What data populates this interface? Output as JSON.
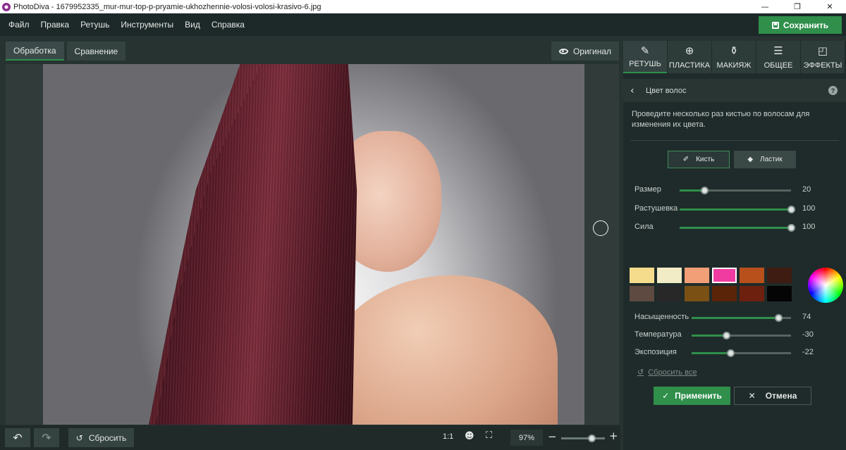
{
  "window": {
    "title": "PhotoDiva - 1679952335_mur-mur-top-p-pryamie-ukhozhennie-volosi-volosi-krasivo-6.jpg",
    "controls": [
      "—",
      "❐",
      "✕"
    ]
  },
  "menu": {
    "items": [
      "Файл",
      "Правка",
      "Ретушь",
      "Инструменты",
      "Вид",
      "Справка"
    ],
    "save_label": "Сохранить"
  },
  "view_tabs": [
    {
      "label": "Обработка",
      "active": true
    },
    {
      "label": "Сравнение",
      "active": false
    }
  ],
  "original_label": "Оригинал",
  "bottom": {
    "reset_label": "Сбросить",
    "ratio_label": "1:1",
    "zoom_value": "97%",
    "zoom_fraction": 0.7
  },
  "panel": {
    "tabs": [
      {
        "label": "РЕТУШЬ",
        "icon": "retouch-brush-icon",
        "active": true
      },
      {
        "label": "ПЛАСТИКА",
        "icon": "plastic-globe-icon",
        "active": false
      },
      {
        "label": "МАКИЯЖ",
        "icon": "makeup-icon",
        "active": false
      },
      {
        "label": "ОБЩЕЕ",
        "icon": "sliders-icon",
        "active": false
      },
      {
        "label": "ЭФФЕКТЫ",
        "icon": "effects-icon",
        "active": false
      }
    ],
    "section_title": "Цвет волос",
    "help": "?",
    "hint": "Проведите несколько раз кистью по волосам для изменения их цвета.",
    "tools": [
      {
        "label": "Кисть",
        "active": true
      },
      {
        "label": "Ластик",
        "active": false
      }
    ],
    "brush_sliders": [
      {
        "label": "Размер",
        "value": "20",
        "fraction": 0.22
      },
      {
        "label": "Растушевка",
        "value": "100",
        "fraction": 1.0
      },
      {
        "label": "Сила",
        "value": "100",
        "fraction": 1.0
      }
    ],
    "swatches": [
      {
        "color": "#f5dc8c"
      },
      {
        "color": "#f2ecc6"
      },
      {
        "color": "#f29e76"
      },
      {
        "color": "#f03ca0",
        "selected": true
      },
      {
        "color": "#b8501c"
      },
      {
        "color": "#3f1c12"
      },
      {
        "color": "#5e4a40"
      },
      {
        "color": "#282828"
      },
      {
        "color": "#7a5014"
      },
      {
        "color": "#5a2408"
      },
      {
        "color": "#6e200e"
      },
      {
        "color": "#050505"
      }
    ],
    "color_sliders": [
      {
        "label": "Насыщенность",
        "value": "74",
        "fraction": 0.87
      },
      {
        "label": "Температура",
        "value": "-30",
        "fraction": 0.35
      },
      {
        "label": "Экспозиция",
        "value": "-22",
        "fraction": 0.39
      }
    ],
    "reset_all_label": "Сбросить все",
    "apply_label": "Применить",
    "cancel_label": "Отмена"
  }
}
